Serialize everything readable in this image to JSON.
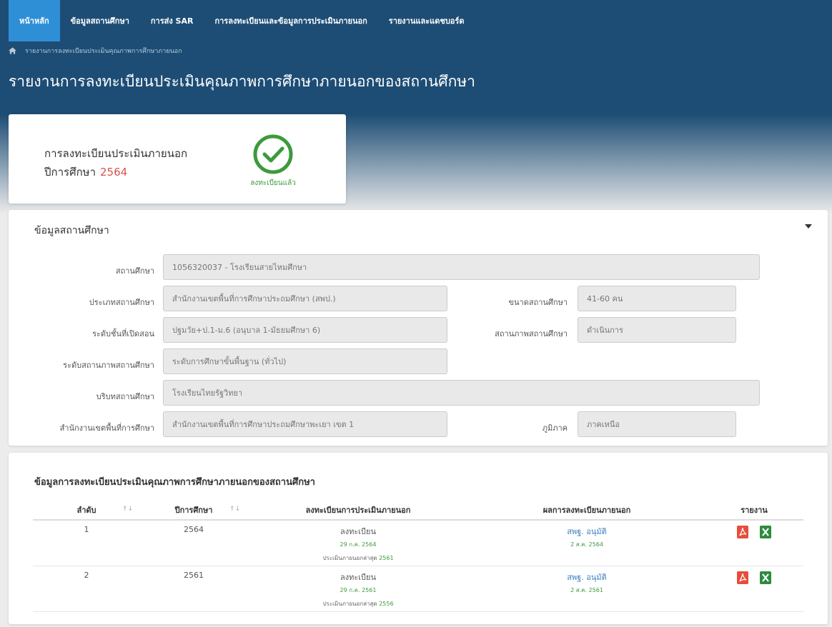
{
  "nav": {
    "items": [
      {
        "label": "หน้าหลัก",
        "active": true
      },
      {
        "label": "ข้อมูลสถานศึกษา",
        "active": false
      },
      {
        "label": "การส่ง SAR",
        "active": false
      },
      {
        "label": "การลงทะเบียนและข้อมูลการประเมินภายนอก",
        "active": false
      },
      {
        "label": "รายงานและแดชบอร์ด",
        "active": false
      }
    ]
  },
  "breadcrumb": {
    "home_icon": "home-icon",
    "current": "รายงานการลงทะเบียนประเมินคุณภาพการศึกษาภายนอก"
  },
  "page_title": "รายงานการลงทะเบียนประเมินคุณภาพการศึกษาภายนอกของสถานศึกษา",
  "registration": {
    "line1": "การลงทะเบียนประเมินภายนอก",
    "year_label": "ปีการศึกษา",
    "year": "2564",
    "status": "ลงทะเบียนแล้ว",
    "status_icon": "check-circle-icon"
  },
  "school_info": {
    "title": "ข้อมูลสถานศึกษา",
    "fields": {
      "school": {
        "label": "สถานศึกษา",
        "value": "1056320037 - โรงเรียนสายไหมศึกษา"
      },
      "school_type": {
        "label": "ประเภทสถานศึกษา",
        "value": "สำนักงานเขตพื้นที่การศึกษาประถมศึกษา (สพป.)"
      },
      "school_size": {
        "label": "ขนาดสถานศึกษา",
        "value": "41-60 คน"
      },
      "levels": {
        "label": "ระดับชั้นที่เปิดสอน",
        "value": "ปฐมวัย+ป.1-ม.6 (อนุบาล 1-มัธยมศึกษา 6)"
      },
      "status": {
        "label": "สถานภาพสถานศึกษา",
        "value": "ดำเนินการ"
      },
      "level_status": {
        "label": "ระดับสถานภาพสถานศึกษา",
        "value": "ระดับการศึกษาขั้นพื้นฐาน (ทั่วไป)"
      },
      "context": {
        "label": "บริบทสถานศึกษา",
        "value": "โรงเรียนไทยรัฐวิทยา"
      },
      "office": {
        "label": "สำนักงานเขตพื้นที่การศึกษา",
        "value": "สำนักงานเขตพื้นที่การศึกษาประถมศึกษาพะเยา เขต 1"
      },
      "region": {
        "label": "ภูมิภาค",
        "value": "ภาคเหนือ"
      }
    }
  },
  "reg_table": {
    "title": "ข้อมูลการลงทะเบียนประเมินคุณภาพการศึกษาภายนอกของสถานศึกษา",
    "headers": [
      "ลำดับ",
      "ปีการศึกษา",
      "ลงทะเบียนการประเมินภายนอก",
      "ผลการลงทะเบียนภายนอก",
      "รายงาน"
    ],
    "sort_icon": "↑↓",
    "rows": [
      {
        "no": "1",
        "year": "2564",
        "reg_label": "ลงทะเบียน",
        "reg_date": "29 ก.ค. 2564",
        "last_eval_label": "ประเมินภายนอกล่าสุด",
        "last_eval_year": "2561",
        "result_label": "สพฐ. อนุมัติ",
        "result_date": "2 ส.ค. 2564"
      },
      {
        "no": "2",
        "year": "2561",
        "reg_label": "ลงทะเบียน",
        "reg_date": "29 ก.ค. 2561",
        "last_eval_label": "ประเมินภายนอกล่าสุด",
        "last_eval_year": "2556",
        "result_label": "สพฐ. อนุมัติ",
        "result_date": "2 ส.ค. 2561"
      }
    ],
    "icons": {
      "pdf": "pdf-file-icon",
      "excel": "excel-file-icon"
    },
    "colors": {
      "pdf": "#e74c3c",
      "excel": "#2e8b3e",
      "approved": "#3a7fc1",
      "date": "#3c9a3c"
    }
  },
  "colors": {
    "header_bg": "#1d4d75",
    "nav_active": "#2e8fd6",
    "year_red": "#d9534f",
    "check_green": "#3c9a3c"
  }
}
